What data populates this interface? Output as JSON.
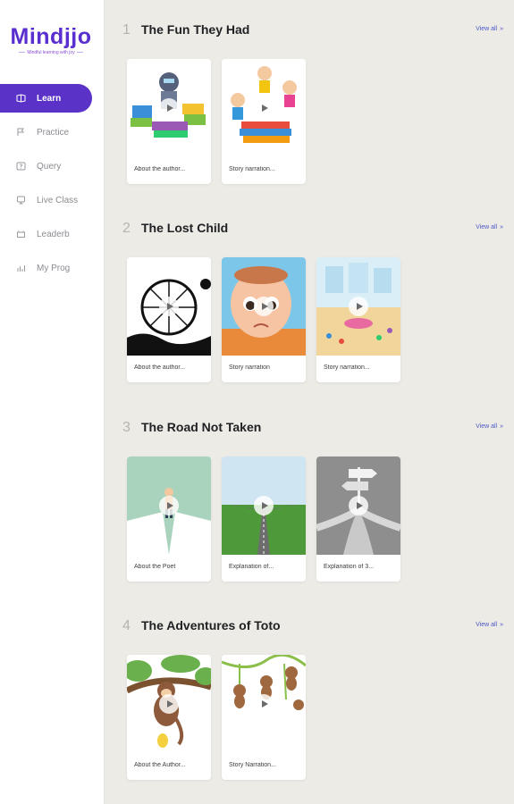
{
  "brand": {
    "name": "Mindjjo",
    "tagline": "Mindful learning with joy",
    "accent": "#5a32c8"
  },
  "sidebar": {
    "items": [
      {
        "label": "Learn",
        "icon": "book-icon",
        "active": true
      },
      {
        "label": "Practice",
        "icon": "flag-icon",
        "active": false
      },
      {
        "label": "Query",
        "icon": "question-icon",
        "active": false
      },
      {
        "label": "Live Class",
        "icon": "live-icon",
        "active": false
      },
      {
        "label": "Leaderb",
        "icon": "trophy-icon",
        "active": false
      },
      {
        "label": "My Prog",
        "icon": "chart-icon",
        "active": false
      }
    ]
  },
  "sections": [
    {
      "number": "1",
      "title": "The Fun They Had",
      "view_all": "View all",
      "cards": [
        {
          "caption": "About the author...",
          "thumb": "robot-books"
        },
        {
          "caption": "Story narration...",
          "thumb": "kids-reading"
        }
      ]
    },
    {
      "number": "2",
      "title": "The Lost Child",
      "view_all": "View all",
      "cards": [
        {
          "caption": "About the author...",
          "thumb": "ferris-wheel"
        },
        {
          "caption": "Story narration",
          "thumb": "crying-child"
        },
        {
          "caption": "Story narration...",
          "thumb": "fair-crowd"
        }
      ]
    },
    {
      "number": "3",
      "title": "The Road Not Taken",
      "view_all": "View all",
      "cards": [
        {
          "caption": "About the Poet",
          "thumb": "man-crossroads"
        },
        {
          "caption": "Explanation of...",
          "thumb": "forked-road"
        },
        {
          "caption": "Explanation of 3...",
          "thumb": "gray-fork"
        }
      ]
    },
    {
      "number": "4",
      "title": "The Adventures of Toto",
      "view_all": "View all",
      "cards": [
        {
          "caption": "About the Author...",
          "thumb": "monkey-tree"
        },
        {
          "caption": "Story Narration...",
          "thumb": "monkeys-vines"
        }
      ]
    }
  ]
}
